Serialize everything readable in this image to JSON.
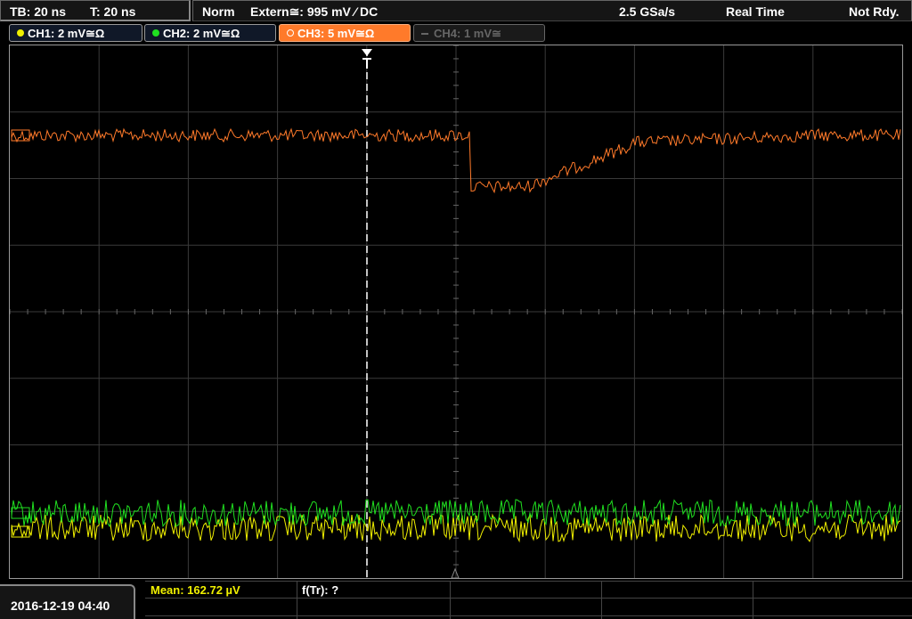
{
  "status_bar": {
    "timebase": "TB: 20 ns",
    "trigger_time": "T: 20 ns",
    "trigger_mode": "Norm",
    "trigger_source": "Extern≅: 995 mV ⁄ DC",
    "sample_rate": "2.5 GSa/s",
    "acq_mode": "Real Time",
    "state": "Not Rdy."
  },
  "channels": [
    {
      "label": "CH1: 2 mV≅Ω",
      "color": "#f0f000",
      "active": true
    },
    {
      "label": "CH2: 2 mV≅Ω",
      "color": "#20e020",
      "active": true
    },
    {
      "label": "CH3: 5 mV≅Ω",
      "color": "#ff7a2a",
      "active": true,
      "selected": true
    },
    {
      "label": "CH4: 1 mV≅",
      "color": "#777777",
      "active": false
    }
  ],
  "measurements": {
    "mean": "Mean: 162.72 µV",
    "freq": "f(Tr): ?"
  },
  "timestamp": "2016-12-19 04:40",
  "colors": {
    "ch1": "#f0f000",
    "ch2": "#20e020",
    "ch3": "#ff7a2a",
    "grid": "#3a3a3a"
  }
}
